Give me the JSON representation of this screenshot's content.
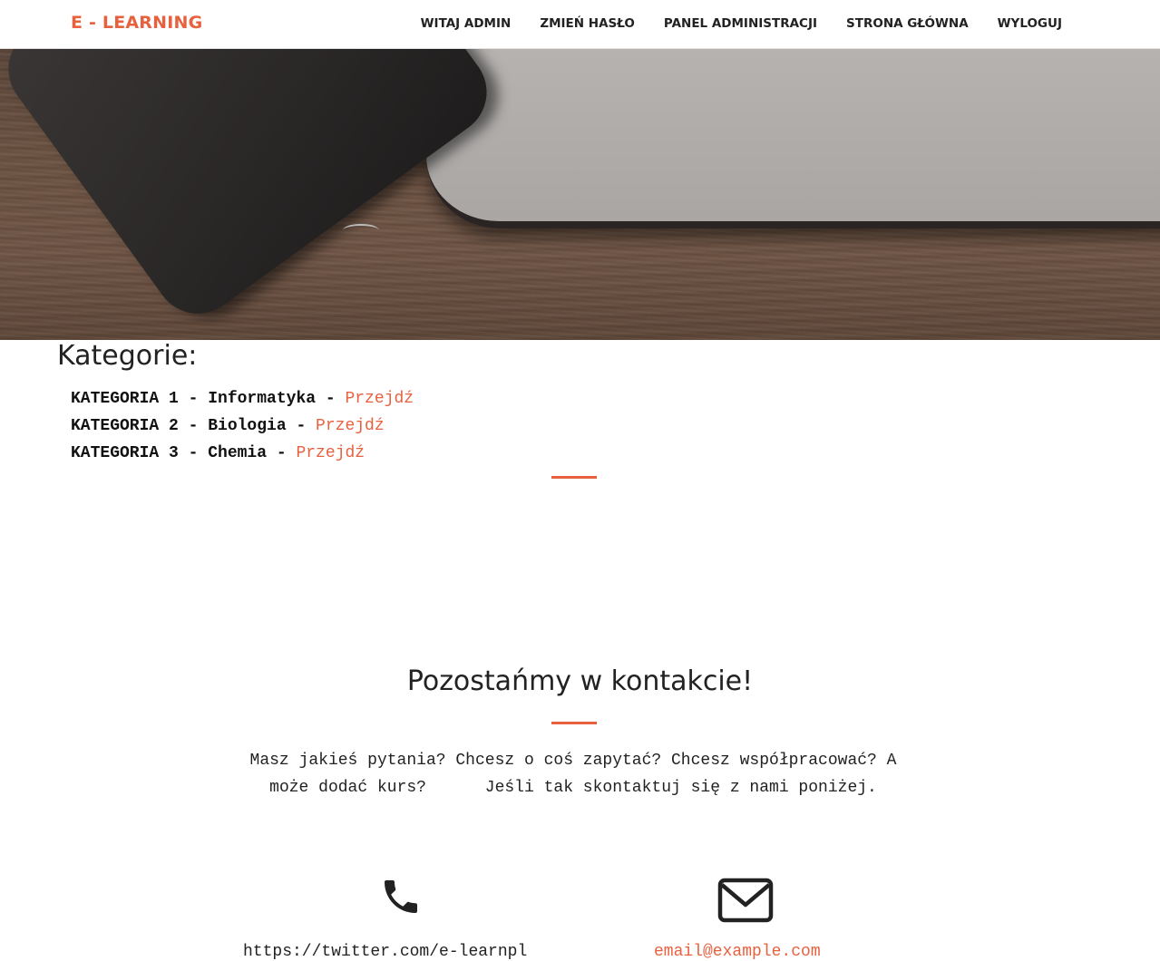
{
  "navbar": {
    "brand": "E - LEARNING",
    "items": [
      {
        "label": "WITAJ ADMIN"
      },
      {
        "label": "ZMIEŃ HASŁO"
      },
      {
        "label": "PANEL ADMINISTRACJI"
      },
      {
        "label": "STRONA GŁÓWNA"
      },
      {
        "label": "WYLOGUJ"
      }
    ]
  },
  "categories": {
    "title": "Kategorie:",
    "items": [
      {
        "name": "KATEGORIA 1 - Informatyka",
        "separator": " - ",
        "link": "Przejdź"
      },
      {
        "name": "KATEGORIA 2 - Biologia",
        "separator": " - ",
        "link": "Przejdź"
      },
      {
        "name": "KATEGORIA 3 - Chemia",
        "separator": " - ",
        "link": "Przejdź"
      }
    ]
  },
  "contact": {
    "title": "Pozostańmy w kontakcie!",
    "text": "Masz jakieś pytania? Chcesz o coś zapytać? Chcesz współpracować? A może dodać kurs?      Jeśli tak skontaktuj się z nami poniżej.",
    "twitter": "https://twitter.com/e-learnpl",
    "email": "email@example.com"
  },
  "colors": {
    "accent": "#e8613f",
    "text": "#222222"
  },
  "icons": {
    "phone": "phone-icon",
    "email": "envelope-icon"
  }
}
